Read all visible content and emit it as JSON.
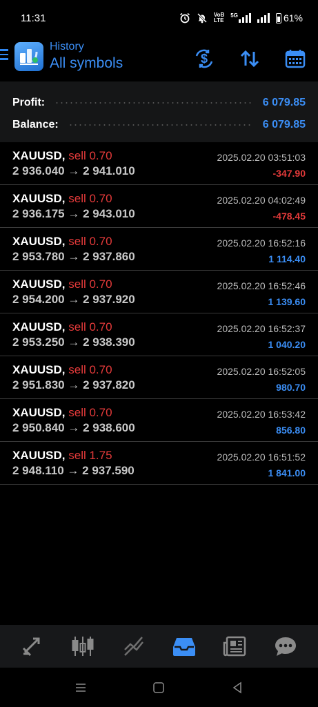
{
  "status_bar": {
    "time": "11:31",
    "network_label_top": "VoB",
    "network_label_bottom": "LTE",
    "network_5g": "5G",
    "battery": "61%",
    "icons": [
      "alarm-icon",
      "bell-muted-icon",
      "signal-icon",
      "signal-icon",
      "battery-icon"
    ]
  },
  "header": {
    "title": "History",
    "subtitle": "All symbols",
    "icons": [
      "menu-icon",
      "app-logo-icon",
      "currency-exchange-icon",
      "sort-icon",
      "calendar-icon"
    ]
  },
  "summary": {
    "profit_label": "Profit:",
    "profit_value": "6 079.85",
    "balance_label": "Balance:",
    "balance_value": "6 079.85"
  },
  "trades": [
    {
      "symbol": "XAUUSD,",
      "side": "sell 0.70",
      "prices": "2 936.040 → 2 941.010",
      "time": "2025.02.20 03:51:03",
      "pl": "-347.90",
      "pl_sign": "neg"
    },
    {
      "symbol": "XAUUSD,",
      "side": "sell 0.70",
      "prices": "2 936.175 → 2 943.010",
      "time": "2025.02.20 04:02:49",
      "pl": "-478.45",
      "pl_sign": "neg"
    },
    {
      "symbol": "XAUUSD,",
      "side": "sell 0.70",
      "prices": "2 953.780 → 2 937.860",
      "time": "2025.02.20 16:52:16",
      "pl": "1 114.40",
      "pl_sign": "pos"
    },
    {
      "symbol": "XAUUSD,",
      "side": "sell 0.70",
      "prices": "2 954.200 → 2 937.920",
      "time": "2025.02.20 16:52:46",
      "pl": "1 139.60",
      "pl_sign": "pos"
    },
    {
      "symbol": "XAUUSD,",
      "side": "sell 0.70",
      "prices": "2 953.250 → 2 938.390",
      "time": "2025.02.20 16:52:37",
      "pl": "1 040.20",
      "pl_sign": "pos"
    },
    {
      "symbol": "XAUUSD,",
      "side": "sell 0.70",
      "prices": "2 951.830 → 2 937.820",
      "time": "2025.02.20 16:52:05",
      "pl": "980.70",
      "pl_sign": "pos"
    },
    {
      "symbol": "XAUUSD,",
      "side": "sell 0.70",
      "prices": "2 950.840 → 2 938.600",
      "time": "2025.02.20 16:53:42",
      "pl": "856.80",
      "pl_sign": "pos"
    },
    {
      "symbol": "XAUUSD,",
      "side": "sell 1.75",
      "prices": "2 948.110 → 2 937.590",
      "time": "2025.02.20 16:51:52",
      "pl": "1 841.00",
      "pl_sign": "pos"
    }
  ],
  "bottom_tabs": [
    {
      "icon": "quotes-icon",
      "active": false
    },
    {
      "icon": "candlestick-chart-icon",
      "active": false
    },
    {
      "icon": "trade-icon",
      "active": false
    },
    {
      "icon": "history-inbox-icon",
      "active": true
    },
    {
      "icon": "news-icon",
      "active": false
    },
    {
      "icon": "messages-icon",
      "active": false
    }
  ],
  "nav_bar": {
    "icons": [
      "recent-apps-icon",
      "home-icon",
      "back-icon"
    ]
  },
  "colors": {
    "accent": "#3b8ef5",
    "loss": "#e43a3a",
    "background": "#000000",
    "panel": "#151617"
  }
}
